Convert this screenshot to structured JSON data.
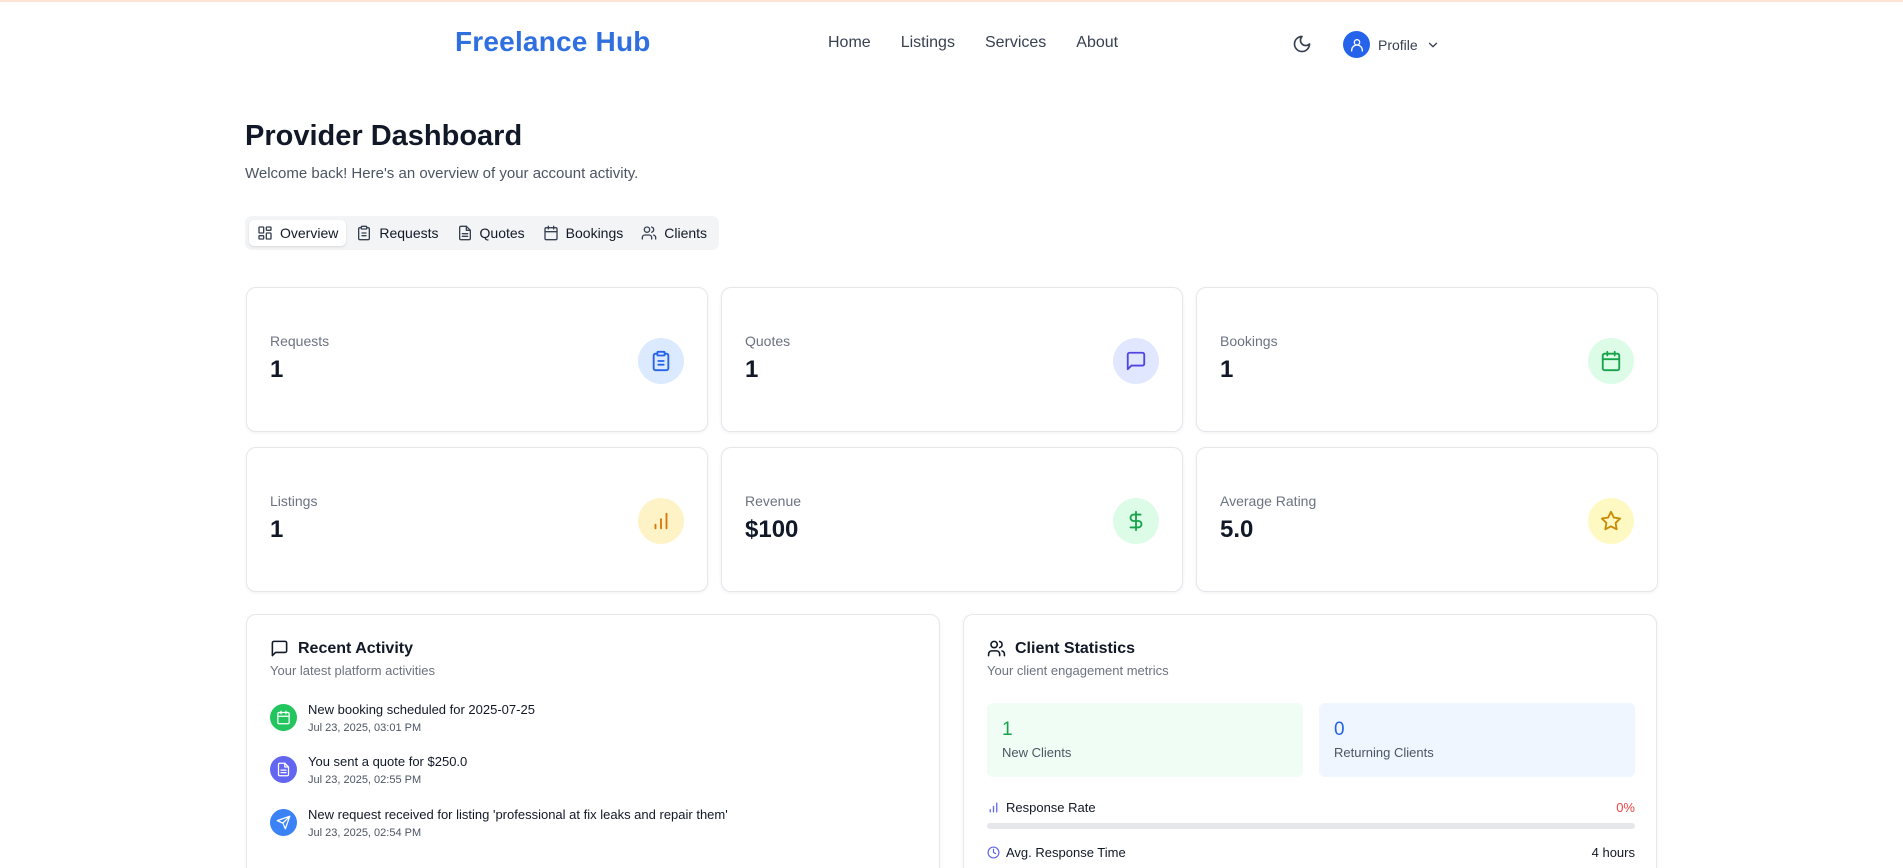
{
  "header": {
    "logo": "Freelance Hub",
    "nav": [
      "Home",
      "Listings",
      "Services",
      "About"
    ],
    "profile_label": "Profile"
  },
  "page": {
    "title": "Provider Dashboard",
    "subtitle": "Welcome back! Here's an overview of your account activity."
  },
  "tabs": [
    {
      "label": "Overview",
      "icon": "layout-dashboard-icon",
      "active": true
    },
    {
      "label": "Requests",
      "icon": "clipboard-icon",
      "active": false
    },
    {
      "label": "Quotes",
      "icon": "file-text-icon",
      "active": false
    },
    {
      "label": "Bookings",
      "icon": "calendar-icon",
      "active": false
    },
    {
      "label": "Clients",
      "icon": "users-icon",
      "active": false
    }
  ],
  "stats": [
    {
      "label": "Requests",
      "value": "1",
      "icon": "clipboard-icon",
      "bg": "#dbeafe",
      "color": "#2563eb"
    },
    {
      "label": "Quotes",
      "value": "1",
      "icon": "message-square-icon",
      "bg": "#e0e7ff",
      "color": "#4f46e5"
    },
    {
      "label": "Bookings",
      "value": "1",
      "icon": "calendar-icon",
      "bg": "#dcfce7",
      "color": "#16a34a"
    },
    {
      "label": "Listings",
      "value": "1",
      "icon": "bar-chart-icon",
      "bg": "#fef3c7",
      "color": "#d97706"
    },
    {
      "label": "Revenue",
      "value": "$100",
      "icon": "dollar-icon",
      "bg": "#dcfce7",
      "color": "#16a34a"
    },
    {
      "label": "Average Rating",
      "value": "5.0",
      "icon": "star-icon",
      "bg": "#fef9c3",
      "color": "#ca8a04"
    }
  ],
  "recent_activity": {
    "title": "Recent Activity",
    "subtitle": "Your latest platform activities",
    "items": [
      {
        "text": "New booking scheduled for 2025-07-25",
        "time": "Jul 23, 2025, 03:01 PM",
        "icon": "calendar-icon",
        "color": "#22c55e"
      },
      {
        "text": "You sent a quote for $250.0",
        "time": "Jul 23, 2025, 02:55 PM",
        "icon": "file-text-icon",
        "color": "#6366f1"
      },
      {
        "text": "New request received for listing 'professional at fix leaks and repair them'",
        "time": "Jul 23, 2025, 02:54 PM",
        "icon": "send-icon",
        "color": "#3b82f6"
      }
    ]
  },
  "client_statistics": {
    "title": "Client Statistics",
    "subtitle": "Your client engagement metrics",
    "new_clients": {
      "value": "1",
      "label": "New Clients"
    },
    "returning_clients": {
      "value": "0",
      "label": "Returning Clients"
    },
    "response_rate": {
      "label": "Response Rate",
      "value": "0%",
      "fraction": 0
    },
    "avg_response_time": {
      "label": "Avg. Response Time",
      "value": "4 hours"
    }
  },
  "colors": {
    "brand": "#2f6fe0",
    "accent": "#2563eb",
    "danger": "#ef4444"
  }
}
